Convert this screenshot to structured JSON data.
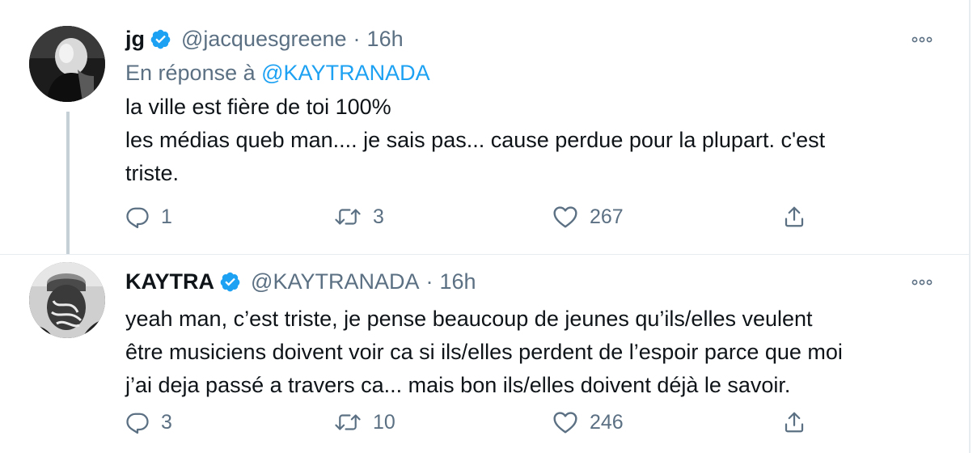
{
  "thread": [
    {
      "name": "jg",
      "handle": "@jacquesgreene",
      "separator": "·",
      "time": "16h",
      "reply_prefix": "En réponse à",
      "reply_to": "@KAYTRANADA",
      "lines": [
        "la ville est fière de toi 100%",
        "les médias queb man.... je sais pas... cause perdue pour la plupart. c'est",
        "triste."
      ],
      "replies": "1",
      "retweets": "3",
      "likes": "267"
    },
    {
      "name": "KAYTRA",
      "handle": "@KAYTRANADA",
      "separator": "·",
      "time": "16h",
      "lines": [
        "yeah man, c’est triste, je pense beaucoup de jeunes qu’ils/elles veulent",
        "être musiciens doivent voir ca si ils/elles perdent de l’espoir parce que moi",
        "j’ai deja passé a travers ca... mais bon ils/elles doivent déjà le savoir."
      ],
      "replies": "3",
      "retweets": "10",
      "likes": "246"
    }
  ],
  "icons": {
    "verified": "verified-badge-icon",
    "more": "more-options-icon",
    "reply": "reply-icon",
    "retweet": "retweet-icon",
    "like": "heart-icon",
    "share": "share-icon"
  },
  "colors": {
    "text": "#0f1419",
    "secondary": "#5b7083",
    "link": "#1da1f2",
    "thread_line": "#c4cfd6",
    "divider": "#e6ecf0"
  }
}
